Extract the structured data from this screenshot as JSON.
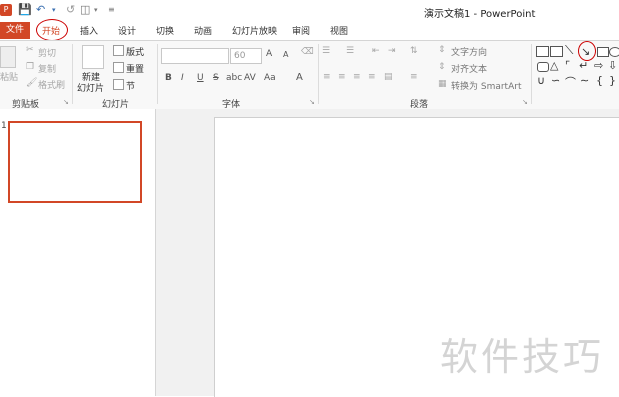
{
  "window": {
    "title": "演示文稿1 - PowerPoint"
  },
  "quick_access": {
    "app_icon": "P",
    "save_icon": "save-icon",
    "undo_icon": "undo-icon",
    "redo_icon": "redo-icon",
    "customize_icon": "dropdown-icon"
  },
  "tabs": [
    {
      "label": "文件"
    },
    {
      "label": "开始"
    },
    {
      "label": "插入"
    },
    {
      "label": "设计"
    },
    {
      "label": "切换"
    },
    {
      "label": "动画"
    },
    {
      "label": "幻灯片放映"
    },
    {
      "label": "审阅"
    },
    {
      "label": "视图"
    }
  ],
  "clipboard": {
    "group_label": "剪贴板",
    "paste": "粘贴",
    "cut": "剪切",
    "copy": "复制",
    "format_painter": "格式刷"
  },
  "slides": {
    "group_label": "幻灯片",
    "new_slide_line1": "新建",
    "new_slide_line2": "幻灯片",
    "layout": "版式",
    "reset": "重置",
    "section": "节"
  },
  "font": {
    "group_label": "字体",
    "font_name": "",
    "font_size": "60",
    "grow": "A",
    "shrink": "A",
    "clear": "",
    "bold": "B",
    "italic": "I",
    "underline": "U",
    "strike": "S",
    "spacing": "abc",
    "char_spacing": "AV",
    "case": "Aa",
    "color": "A"
  },
  "paragraph": {
    "group_label": "段落",
    "text_direction": "文字方向",
    "align_text": "对齐文本",
    "smartart": "转换为 SmartArt"
  },
  "drawing": {
    "group_label": ""
  },
  "thumbnails": [
    {
      "number": "1"
    }
  ],
  "watermark": "软件技巧",
  "colors": {
    "accent": "#d24726",
    "annotation": "#cc0000"
  }
}
